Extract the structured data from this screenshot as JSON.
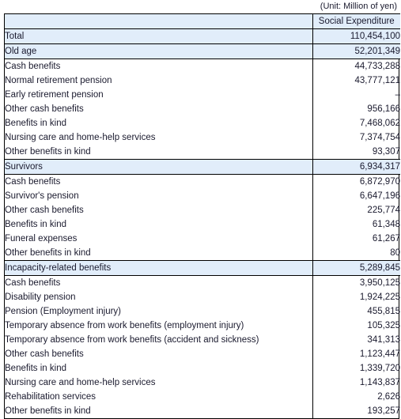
{
  "unit_note": "(Unit: Million of yen)",
  "table": {
    "columns": [
      {
        "key": "label",
        "header": ""
      },
      {
        "key": "value",
        "header": "Social Expenditure"
      }
    ],
    "rows": [
      {
        "label": "Total",
        "value": "110,454,100",
        "level": 0,
        "style": "total"
      },
      {
        "label": "Old age",
        "value": "52,201,349",
        "level": 0,
        "style": "section"
      },
      {
        "label": "Cash benefits",
        "value": "44,733,288",
        "level": 1,
        "style": "plain"
      },
      {
        "label": "Normal retirement pension",
        "value": "43,777,121",
        "level": 2,
        "style": "plain"
      },
      {
        "label": "Early retirement pension",
        "value": "–",
        "level": 2,
        "style": "plain"
      },
      {
        "label": "Other cash benefits",
        "value": "956,166",
        "level": 2,
        "style": "plain"
      },
      {
        "label": "Benefits in kind",
        "value": "7,468,062",
        "level": 1,
        "style": "plain"
      },
      {
        "label": "Nursing care and home-help services",
        "value": "7,374,754",
        "level": 2,
        "style": "plain"
      },
      {
        "label": "Other benefits in kind",
        "value": "93,307",
        "level": 2,
        "style": "plain"
      },
      {
        "label": "Survivors",
        "value": "6,934,317",
        "level": 0,
        "style": "section"
      },
      {
        "label": "Cash benefits",
        "value": "6,872,970",
        "level": 1,
        "style": "plain"
      },
      {
        "label": "Survivor's pension",
        "value": "6,647,196",
        "level": 2,
        "style": "plain"
      },
      {
        "label": "Other cash benefits",
        "value": "225,774",
        "level": 2,
        "style": "plain"
      },
      {
        "label": "Benefits in kind",
        "value": "61,348",
        "level": 1,
        "style": "plain"
      },
      {
        "label": "Funeral expenses",
        "value": "61,267",
        "level": 2,
        "style": "plain"
      },
      {
        "label": "Other benefits in kind",
        "value": "80",
        "level": 2,
        "style": "plain"
      },
      {
        "label": "Incapacity-related benefits",
        "value": "5,289,845",
        "level": 0,
        "style": "section"
      },
      {
        "label": "Cash benefits",
        "value": "3,950,125",
        "level": 1,
        "style": "plain"
      },
      {
        "label": "Disability pension",
        "value": "1,924,225",
        "level": 2,
        "style": "plain"
      },
      {
        "label": "Pension (Employment injury)",
        "value": "455,815",
        "level": 2,
        "style": "plain"
      },
      {
        "label": "Temporary absence from work benefits (employment injury)",
        "value": "105,325",
        "level": 2,
        "style": "plain"
      },
      {
        "label": "Temporary absence from work benefits (accident and sickness)",
        "value": "341,313",
        "level": 2,
        "style": "plain"
      },
      {
        "label": "Other cash benefits",
        "value": "1,123,447",
        "level": 2,
        "style": "plain"
      },
      {
        "label": "Benefits in kind",
        "value": "1,339,720",
        "level": 1,
        "style": "plain"
      },
      {
        "label": "Nursing care and home-help services",
        "value": "1,143,837",
        "level": 2,
        "style": "plain"
      },
      {
        "label": "Rehabilitation services",
        "value": "2,626",
        "level": 2,
        "style": "plain"
      },
      {
        "label": "Other benefits in kind",
        "value": "193,257",
        "level": 2,
        "style": "plain"
      }
    ]
  },
  "colors": {
    "section_background": "#e1edfa",
    "border": "#000000",
    "text": "#1a1a2e",
    "page_background": "#ffffff"
  }
}
